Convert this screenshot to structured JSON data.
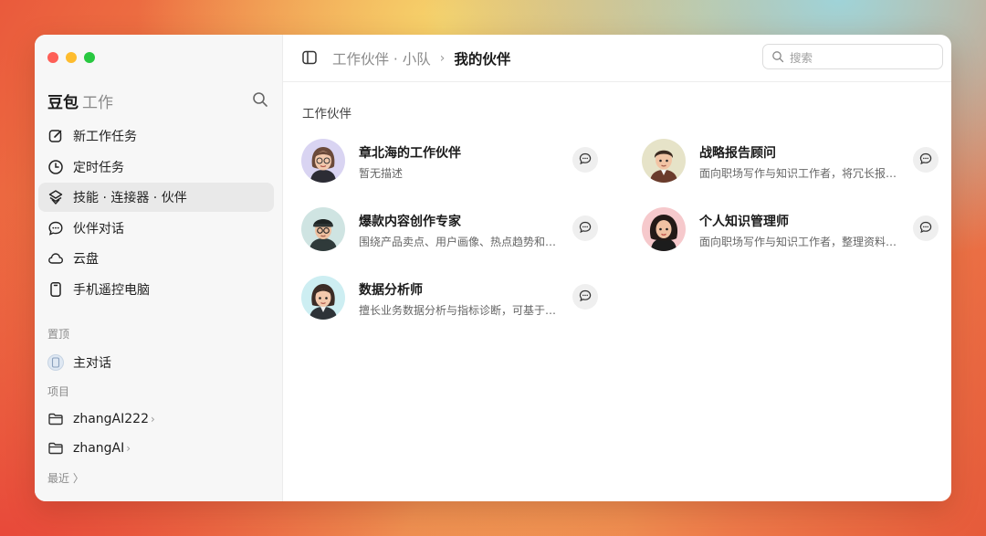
{
  "sidebar": {
    "brand": {
      "name": "豆包",
      "sub": "工作"
    },
    "nav": [
      {
        "label": "新工作任务",
        "icon": "edit-icon"
      },
      {
        "label": "定时任务",
        "icon": "clock-icon"
      },
      {
        "label": "技能 · 连接器 · 伙伴",
        "icon": "layers-icon",
        "active": true
      },
      {
        "label": "伙伴对话",
        "icon": "chat-bubble-icon"
      },
      {
        "label": "云盘",
        "icon": "cloud-icon"
      },
      {
        "label": "手机遥控电脑",
        "icon": "phone-icon"
      }
    ],
    "pinned_label": "置顶",
    "pinned_item": "主对话",
    "projects_label": "项目",
    "projects": [
      {
        "label": "zhangAI222",
        "chevron": "›"
      },
      {
        "label": "zhangAI",
        "chevron": "›"
      }
    ],
    "recent_label": "最近 〉"
  },
  "header": {
    "breadcrumb_parent": "工作伙伴 · 小队",
    "breadcrumb_sep": "›",
    "breadcrumb_current": "我的伙伴",
    "search_placeholder": "搜索"
  },
  "main": {
    "group_title": "工作伙伴",
    "partners": [
      {
        "name": "章北海的工作伙伴",
        "desc": "暂无描述",
        "avatar": "woman-glasses-avatar"
      },
      {
        "name": "战略报告顾问",
        "desc": "面向职场写作与知识工作者，将冗长报…",
        "avatar": "man-suit-avatar"
      },
      {
        "name": "爆款内容创作专家",
        "desc": "围绕产品卖点、用户画像、热点趋势和…",
        "avatar": "man-beanie-avatar"
      },
      {
        "name": "个人知识管理师",
        "desc": "面向职场写作与知识工作者，整理资料…",
        "avatar": "woman-curly-avatar"
      },
      {
        "name": "数据分析师",
        "desc": "擅长业务数据分析与指标诊断，可基于…",
        "avatar": "woman-blazer-avatar"
      }
    ]
  },
  "colors": {
    "accent_active_bg": "#e9e9e9",
    "sidebar_bg": "#f7f7f7"
  }
}
